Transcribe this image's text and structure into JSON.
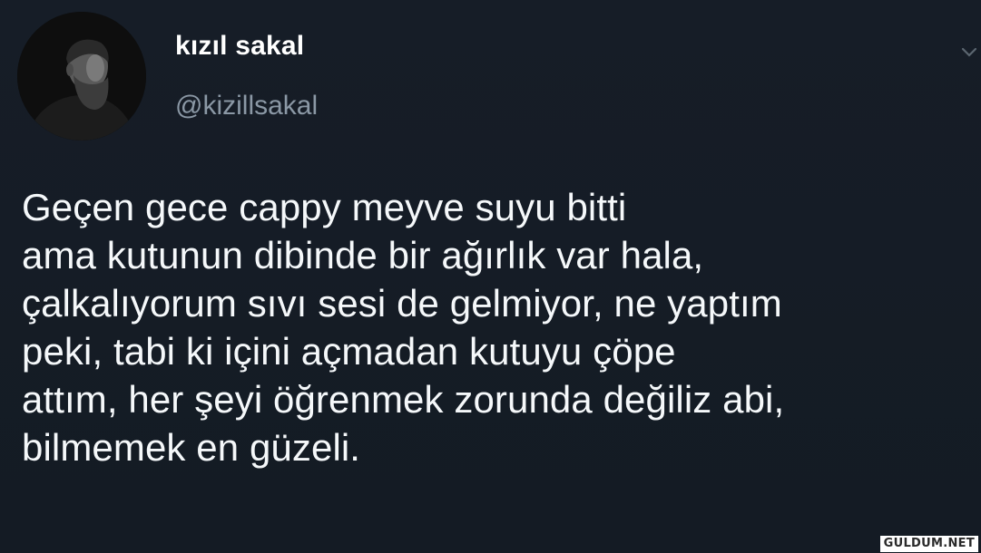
{
  "author": {
    "display_name": "kızıl sakal",
    "handle": "@kizillsakal",
    "avatar_icon": "profile-photo-bearded-man"
  },
  "menu": {
    "icon": "chevron-down-icon"
  },
  "tweet": {
    "lines": [
      "Geçen gece cappy meyve suyu bitti",
      "ama kutunun dibinde bir ağırlık var hala,",
      "çalkalıyorum sıvı sesi de gelmiyor, ne yaptım",
      "peki, tabi ki içini açmadan kutuyu çöpe",
      "attım, her şeyi öğrenmek zorunda değiliz abi,",
      "bilmemek en güzeli."
    ]
  },
  "watermark": {
    "text": "GULDUM.NET"
  },
  "colors": {
    "background": "#151c25",
    "text": "#f5f8fa",
    "handle": "#8b98a5"
  }
}
